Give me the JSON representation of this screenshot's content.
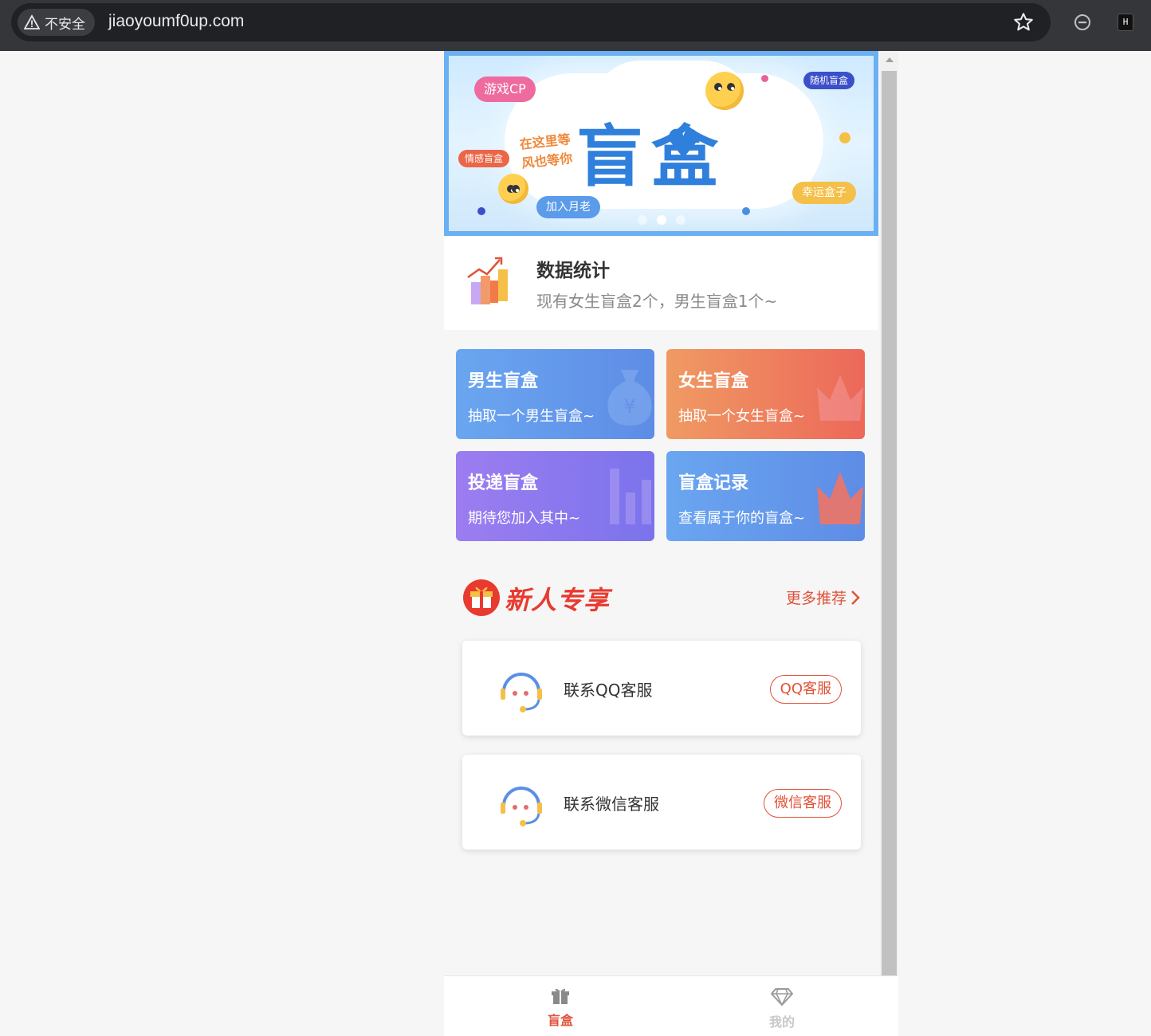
{
  "browser": {
    "security_label": "不安全",
    "url": "jiaoyoumf0up.com"
  },
  "banner": {
    "title": "盲盒",
    "tags": {
      "game_cp": "游戏CP",
      "emotion": "情感盲盒",
      "random": "随机盲盒",
      "join": "加入月老",
      "lucky": "幸运盒子"
    },
    "handwriting": "在这里等风也等你",
    "pager_count": 3,
    "pager_active_index": 1
  },
  "stats": {
    "title": "数据统计",
    "description": "现有女生盲盒2个，男生盲盒1个~"
  },
  "cards": [
    {
      "title": "男生盲盒",
      "subtitle": "抽取一个男生盲盒~"
    },
    {
      "title": "女生盲盒",
      "subtitle": "抽取一个女生盲盒~"
    },
    {
      "title": "投递盲盒",
      "subtitle": "期待您加入其中~"
    },
    {
      "title": "盲盒记录",
      "subtitle": "查看属于你的盲盒~"
    }
  ],
  "promo": {
    "title": "新人专享",
    "more_label": "更多推荐"
  },
  "services": [
    {
      "label": "联系QQ客服",
      "button": "QQ客服"
    },
    {
      "label": "联系微信客服",
      "button": "微信客服"
    }
  ],
  "tabbar": {
    "tabs": [
      {
        "label": "盲盒",
        "icon": "gift-icon",
        "active": true
      },
      {
        "label": "我的",
        "icon": "diamond-icon",
        "active": false
      }
    ]
  },
  "colors": {
    "accent": "#e05238",
    "banner_blue": "#2f7fdc",
    "card_blue": "#5e8ce6",
    "card_orange": "#ec6859",
    "card_purple": "#7b73ec"
  }
}
